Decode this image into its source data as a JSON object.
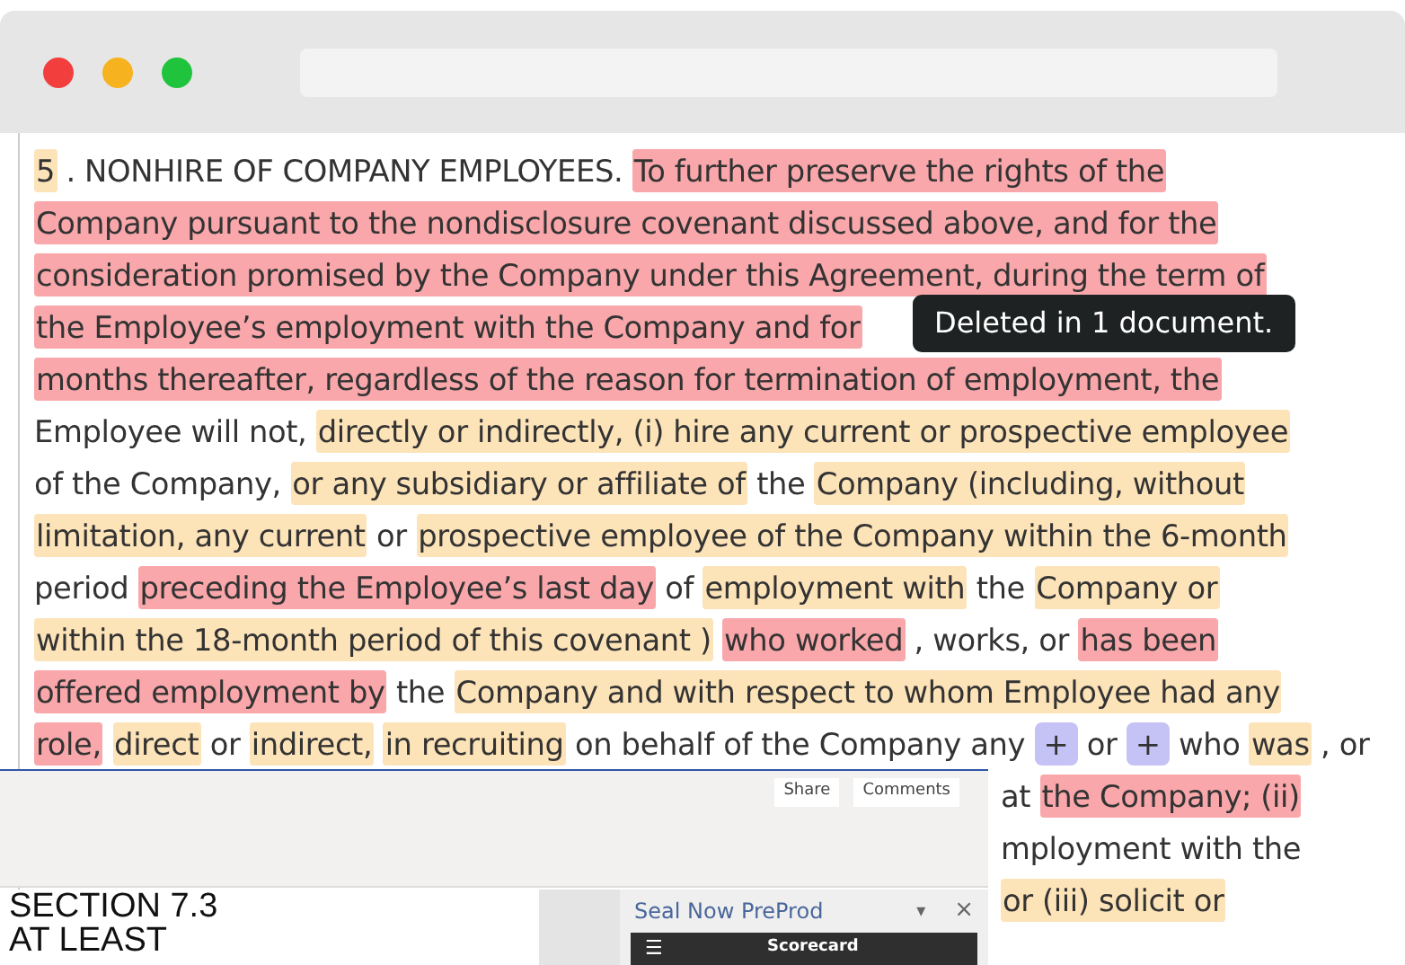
{
  "tooltip": {
    "text": "Deleted in 1 document."
  },
  "document": {
    "lines": [
      {
        "partly_covered": false,
        "segments": [
          {
            "text": "5",
            "kind": "changed"
          },
          {
            "text": ". NONHIRE OF COMPANY EMPLOYEES.",
            "kind": "plain"
          },
          {
            "text": "To further preserve the rights of the",
            "kind": "deleted"
          }
        ]
      },
      {
        "partly_covered": false,
        "segments": [
          {
            "text": "Company pursuant to the nondisclosure covenant discussed above, and for the",
            "kind": "deleted"
          }
        ]
      },
      {
        "partly_covered": false,
        "segments": [
          {
            "text": "consideration promised by the Company under this Agreement, during the term of",
            "kind": "deleted"
          }
        ]
      },
      {
        "partly_covered": false,
        "segments": [
          {
            "text": "the Employee’s employment with the Company and for",
            "kind": "deleted"
          }
        ]
      },
      {
        "partly_covered": false,
        "segments": [
          {
            "text": "months thereafter, regardless of the reason for termination of employment, the",
            "kind": "deleted"
          }
        ]
      },
      {
        "partly_covered": false,
        "segments": [
          {
            "text": "Employee will not,",
            "kind": "plain"
          },
          {
            "text": "directly or indirectly, (i) hire any current or prospective employee",
            "kind": "changed"
          }
        ]
      },
      {
        "partly_covered": false,
        "segments": [
          {
            "text": "of the Company,",
            "kind": "plain"
          },
          {
            "text": "or any subsidiary or affiliate of",
            "kind": "changed"
          },
          {
            "text": "the",
            "kind": "plain"
          },
          {
            "text": "Company (including, without",
            "kind": "changed"
          }
        ]
      },
      {
        "partly_covered": false,
        "segments": [
          {
            "text": "limitation, any current",
            "kind": "changed"
          },
          {
            "text": "or",
            "kind": "plain"
          },
          {
            "text": "prospective employee of the Company within the 6-month",
            "kind": "changed"
          }
        ]
      },
      {
        "partly_covered": false,
        "segments": [
          {
            "text": "period",
            "kind": "plain"
          },
          {
            "text": "preceding the Employee’s last day",
            "kind": "deleted"
          },
          {
            "text": "of",
            "kind": "plain"
          },
          {
            "text": "employment with",
            "kind": "changed"
          },
          {
            "text": "the",
            "kind": "plain"
          },
          {
            "text": "Company or",
            "kind": "changed"
          }
        ]
      },
      {
        "partly_covered": false,
        "segments": [
          {
            "text": "within the 18-month period of this covenant )",
            "kind": "changed"
          },
          {
            "text": "who worked",
            "kind": "deleted"
          },
          {
            "text": ", works, or",
            "kind": "plain"
          },
          {
            "text": "has been",
            "kind": "deleted"
          }
        ]
      },
      {
        "partly_covered": false,
        "segments": [
          {
            "text": "offered employment by",
            "kind": "deleted"
          },
          {
            "text": "the",
            "kind": "plain"
          },
          {
            "text": "Company and with respect to whom Employee had any",
            "kind": "changed"
          }
        ]
      },
      {
        "partly_covered": false,
        "segments": [
          {
            "text": "role,",
            "kind": "deleted"
          },
          {
            "text": "direct",
            "kind": "changed"
          },
          {
            "text": "or",
            "kind": "plain"
          },
          {
            "text": "indirect,",
            "kind": "changed"
          },
          {
            "text": "in recruiting",
            "kind": "changed"
          },
          {
            "text": "on behalf of the Company",
            "kind": "plain"
          },
          {
            "text": "any",
            "kind": "plain"
          },
          {
            "text": "+",
            "kind": "added"
          },
          {
            "text": "or",
            "kind": "plain"
          },
          {
            "text": "+",
            "kind": "added"
          },
          {
            "text": "who",
            "kind": "plain"
          },
          {
            "text": "was",
            "kind": "changed"
          },
          {
            "text": ", or",
            "kind": "plain"
          }
        ]
      },
      {
        "partly_covered": true,
        "segments": [
          {
            "text": "at",
            "kind": "plain"
          },
          {
            "text": "the Company; (ii)",
            "kind": "deleted"
          }
        ]
      },
      {
        "partly_covered": true,
        "segments": [
          {
            "text": "mployment with the",
            "kind": "plain"
          }
        ]
      },
      {
        "partly_covered": true,
        "segments": [
          {
            "text": "or (iii) solicit or",
            "kind": "changed"
          }
        ]
      }
    ]
  },
  "word_window": {
    "buttons": [
      "Share",
      "Comments"
    ],
    "texts": [
      "SECTION 7.3",
      "AT LEAST"
    ]
  },
  "addin_pane": {
    "title": "Seal Now PreProd",
    "caret": "▾",
    "close": "×",
    "menu": "☰",
    "toolbar_title": "Scorecard"
  }
}
